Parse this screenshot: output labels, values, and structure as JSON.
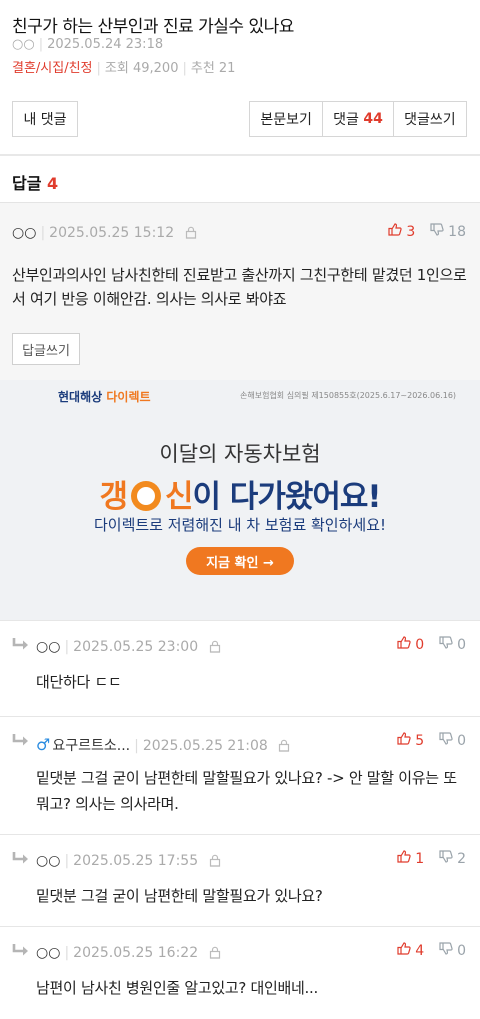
{
  "post": {
    "title": "친구가 하는 산부인과 진료 가실수 있나요",
    "author": "○○",
    "date": "2025.05.24 23:18",
    "category": "결혼/시집/친정",
    "views_label": "조회 49,200",
    "recommend_label": "추천 21"
  },
  "toolbar": {
    "my_comments": "내 댓글",
    "view_post": "본문보기",
    "comments_label": "댓글",
    "comments_count": "44",
    "write_comment": "댓글쓰기"
  },
  "replies": {
    "heading": "답글",
    "count": "4"
  },
  "best_comment": {
    "author": "○○",
    "date": "2025.05.25 15:12",
    "up": "3",
    "down": "18",
    "body": "산부인과의사인 남사친한테 진료받고 출산까지 그친구한테 맡겼던 1인으로서 여기 반응 이해안감. 의사는 의사로 봐야죠",
    "reply_button": "답글쓰기"
  },
  "ad": {
    "brand_a": "현대해상",
    "brand_b": "다이렉트",
    "license": "손해보험협회 심의필 제150855호(2025.6.17~2026.06.16)",
    "line1": "이달의 자동차보험",
    "line2_a": "갱",
    "line2_b": "신",
    "line2_c": "이 다가왔어요!",
    "line3": "다이렉트로 저렴해진 내 차 보험료 확인하세요!",
    "cta": "지금 확인 →"
  },
  "comments": [
    {
      "author": "○○",
      "date": "2025.05.25 23:00",
      "up": "0",
      "down": "0",
      "body": "대단하다 ㄷㄷ"
    },
    {
      "author": "요구르트소...",
      "date": "2025.05.25 21:08",
      "up": "5",
      "down": "0",
      "body": "밑댓분 그걸 굳이 남편한테 말할필요가 있나요? -> 안 말할 이유는 또 뭐고? 의사는 의사라며."
    },
    {
      "author": "○○",
      "date": "2025.05.25 17:55",
      "up": "1",
      "down": "2",
      "body": "밑댓분 그걸 굳이 남편한테 말할필요가 있나요?"
    },
    {
      "author": "○○",
      "date": "2025.05.25 16:22",
      "up": "4",
      "down": "0",
      "body": "남편이 남사친 병원인줄 알고있고? 대인배네..."
    }
  ],
  "colors": {
    "accent": "#e03c2d",
    "down": "#9aa3aa",
    "ad_navy": "#1b3c7c",
    "ad_orange": "#f07820"
  },
  "icons": [
    "lock-icon",
    "thumbs-up-icon",
    "thumbs-down-icon",
    "reply-arrow-icon",
    "male-icon",
    "alarm-clock-icon"
  ]
}
